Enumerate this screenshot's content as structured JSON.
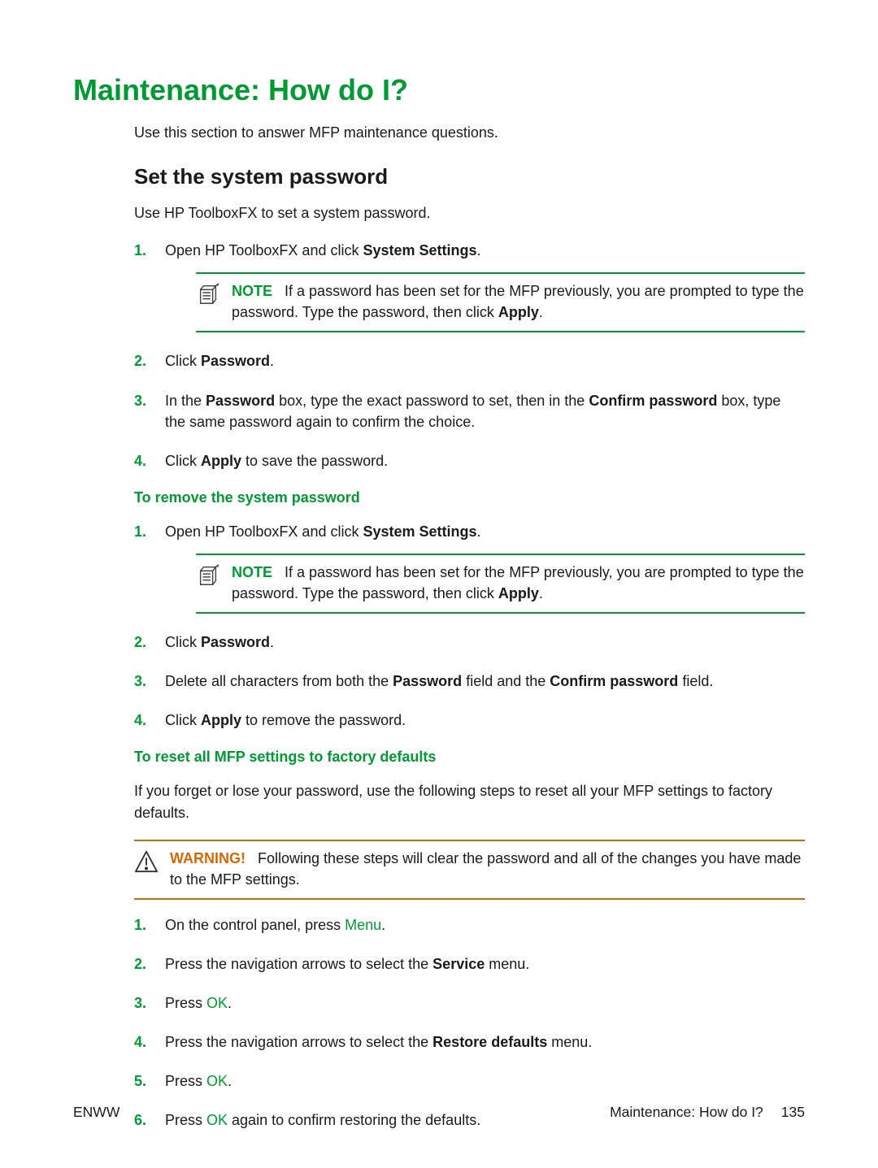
{
  "title": "Maintenance: How do I?",
  "intro": "Use this section to answer MFP maintenance questions.",
  "section1": {
    "heading": "Set the system password",
    "desc": "Use HP ToolboxFX to set a system password.",
    "steps": {
      "s1_a": "Open HP ToolboxFX and click ",
      "s1_b": "System Settings",
      "s1_c": ".",
      "note_label": "NOTE",
      "note_a": "If a password has been set for the MFP previously, you are prompted to type the password. Type the password, then click ",
      "note_b": "Apply",
      "note_c": ".",
      "s2_a": "Click ",
      "s2_b": "Password",
      "s2_c": ".",
      "s3_a": "In the ",
      "s3_b": "Password",
      "s3_c": " box, type the exact password to set, then in the ",
      "s3_d": "Confirm password",
      "s3_e": " box, type the same password again to confirm the choice.",
      "s4_a": "Click ",
      "s4_b": "Apply",
      "s4_c": " to save the password."
    }
  },
  "section2": {
    "heading": "To remove the system password",
    "steps": {
      "s1_a": "Open HP ToolboxFX and click ",
      "s1_b": "System Settings",
      "s1_c": ".",
      "note_label": "NOTE",
      "note_a": "If a password has been set for the MFP previously, you are prompted to type the password. Type the password, then click ",
      "note_b": "Apply",
      "note_c": ".",
      "s2_a": "Click ",
      "s2_b": "Password",
      "s2_c": ".",
      "s3_a": "Delete all characters from both the ",
      "s3_b": "Password",
      "s3_c": " field and the ",
      "s3_d": "Confirm password",
      "s3_e": " field.",
      "s4_a": "Click ",
      "s4_b": "Apply",
      "s4_c": " to remove the password."
    }
  },
  "section3": {
    "heading": "To reset all MFP settings to factory defaults",
    "desc": "If you forget or lose your password, use the following steps to reset all your MFP settings to factory defaults.",
    "warn_label": "WARNING!",
    "warn_text": "Following these steps will clear the password and all of the changes you have made to the MFP settings.",
    "steps": {
      "s1_a": "On the control panel, press ",
      "s1_b": "Menu",
      "s1_c": ".",
      "s2_a": "Press the navigation arrows to select the ",
      "s2_b": "Service",
      "s2_c": " menu.",
      "s3_a": "Press ",
      "s3_b": "OK",
      "s3_c": ".",
      "s4_a": "Press the navigation arrows to select the ",
      "s4_b": "Restore defaults",
      "s4_c": " menu.",
      "s5_a": "Press ",
      "s5_b": "OK",
      "s5_c": ".",
      "s6_a": "Press ",
      "s6_b": "OK",
      "s6_c": " again to confirm restoring the defaults."
    }
  },
  "nums": {
    "n1": "1.",
    "n2": "2.",
    "n3": "3.",
    "n4": "4.",
    "n5": "5.",
    "n6": "6."
  },
  "footer": {
    "left": "ENWW",
    "right_label": "Maintenance: How do I?",
    "page": "135"
  }
}
